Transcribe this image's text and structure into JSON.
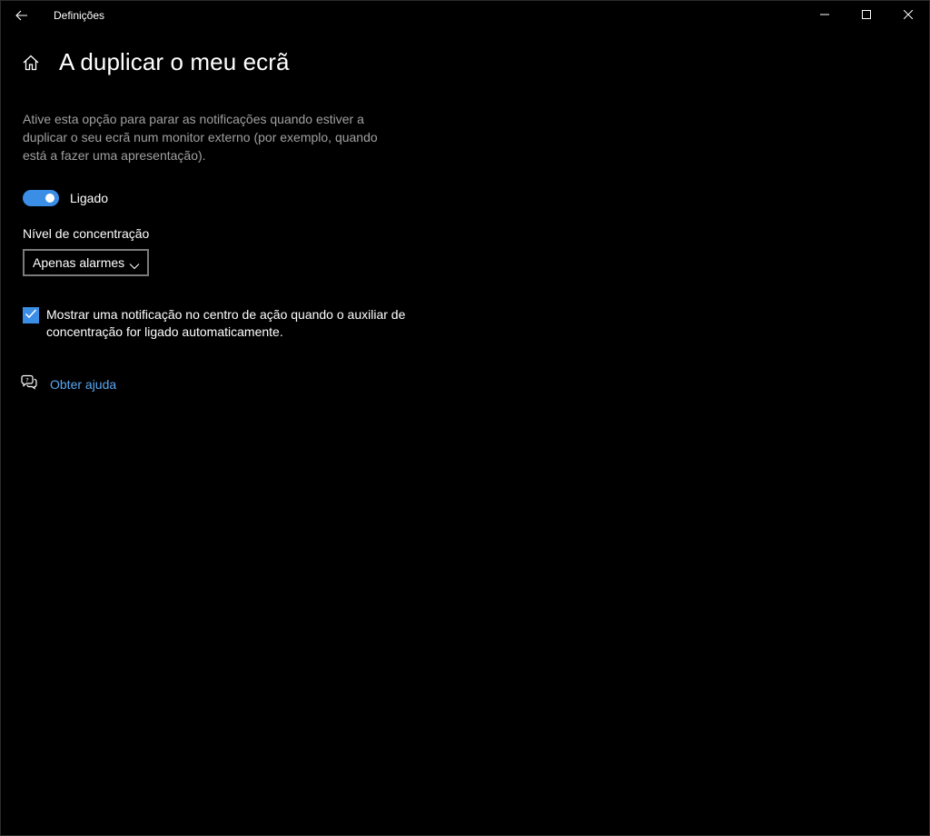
{
  "window": {
    "app_title": "Definições"
  },
  "page": {
    "title": "A duplicar o meu ecrã",
    "description": "Ative esta opção para parar as notificações quando estiver a duplicar o seu ecrã num monitor externo (por exemplo, quando está a fazer uma apresentação)."
  },
  "toggle": {
    "state_label": "Ligado",
    "on": true
  },
  "focus_level": {
    "label": "Nível de concentração",
    "selected": "Apenas alarmes"
  },
  "notification_checkbox": {
    "checked": true,
    "label": "Mostrar uma notificação no centro de ação quando o auxiliar de concentração for ligado automaticamente."
  },
  "help": {
    "link_text": "Obter ajuda"
  },
  "colors": {
    "accent": "#3a8ee6",
    "link": "#5aa7f0",
    "background": "#000000",
    "secondary_text": "#a0a0a0"
  }
}
